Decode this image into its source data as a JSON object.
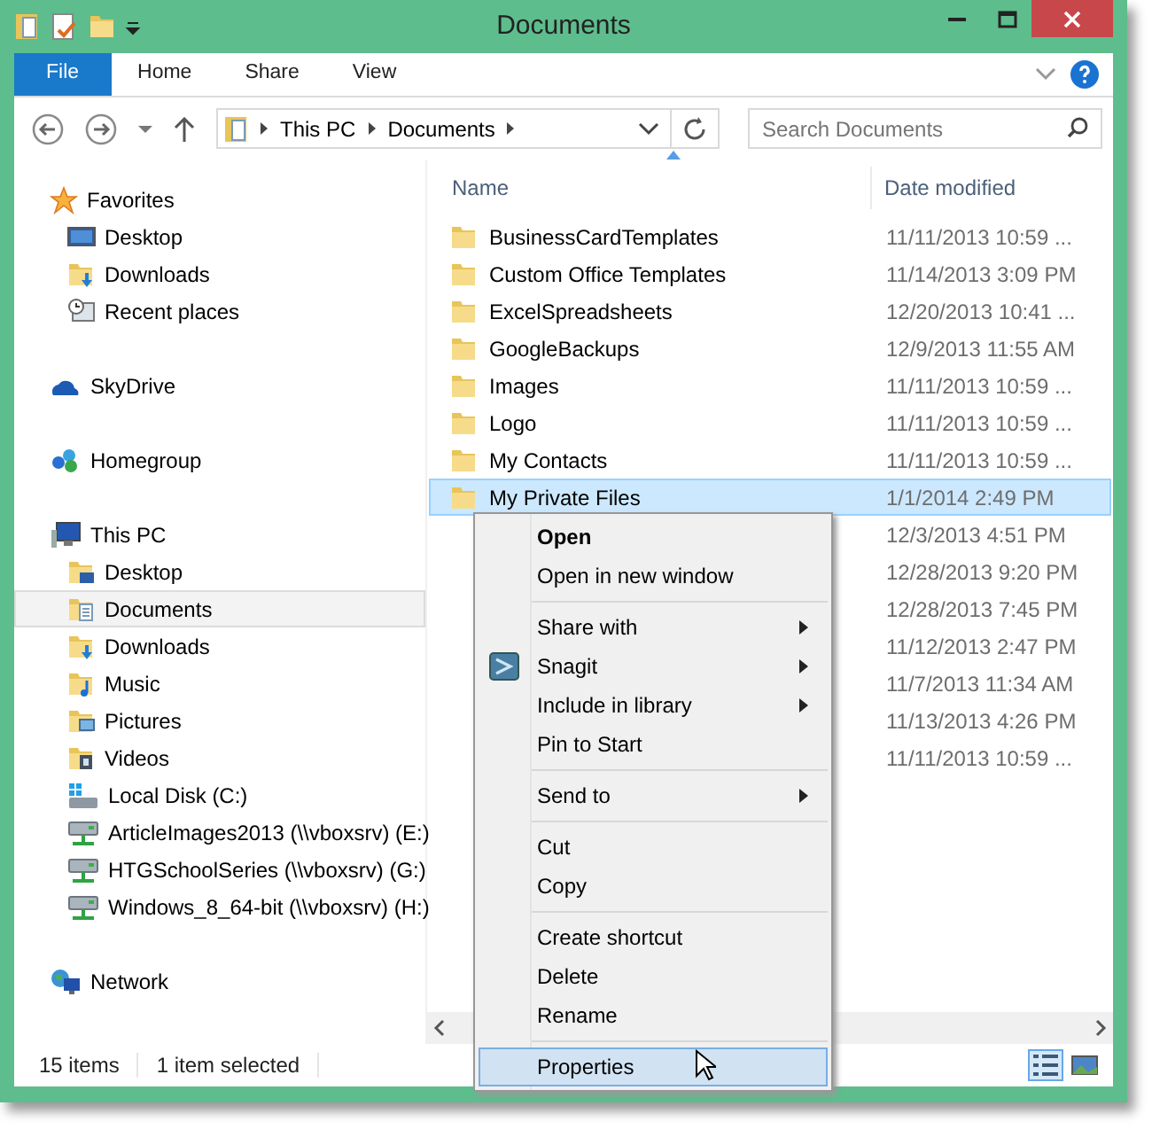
{
  "window": {
    "title": "Documents"
  },
  "ribbon_tabs": [
    {
      "label": "File",
      "kind": "file"
    },
    {
      "label": "Home",
      "kind": "tab"
    },
    {
      "label": "Share",
      "kind": "tab"
    },
    {
      "label": "View",
      "kind": "tab"
    }
  ],
  "address_bar": {
    "path": [
      "This PC",
      "Documents"
    ]
  },
  "search": {
    "placeholder": "Search Documents"
  },
  "navigation": [
    {
      "label": "Favorites",
      "kind": "star",
      "selected": false,
      "children": [
        {
          "label": "Desktop",
          "kind": "desktop",
          "selected": false
        },
        {
          "label": "Downloads",
          "kind": "download-folder",
          "selected": false
        },
        {
          "label": "Recent places",
          "kind": "recent",
          "selected": false
        }
      ]
    },
    {
      "label": "SkyDrive",
      "kind": "cloud",
      "selected": false
    },
    {
      "label": "Homegroup",
      "kind": "homegroup",
      "selected": false
    },
    {
      "label": "This PC",
      "kind": "computer",
      "selected": false,
      "children": [
        {
          "label": "Desktop",
          "kind": "desktop-folder",
          "selected": false
        },
        {
          "label": "Documents",
          "kind": "documents-folder",
          "selected": true
        },
        {
          "label": "Downloads",
          "kind": "download-folder",
          "selected": false
        },
        {
          "label": "Music",
          "kind": "music-folder",
          "selected": false
        },
        {
          "label": "Pictures",
          "kind": "pictures-folder",
          "selected": false
        },
        {
          "label": "Videos",
          "kind": "videos-folder",
          "selected": false
        },
        {
          "label": "Local Disk (C:)",
          "kind": "disk",
          "selected": false
        },
        {
          "label": "ArticleImages2013 (\\\\vboxsrv) (E:)",
          "kind": "network-drive",
          "selected": false
        },
        {
          "label": "HTGSchoolSeries (\\\\vboxsrv) (G:)",
          "kind": "network-drive",
          "selected": false
        },
        {
          "label": "Windows_8_64-bit (\\\\vboxsrv) (H:)",
          "kind": "network-drive",
          "selected": false
        }
      ]
    },
    {
      "label": "Network",
      "kind": "network",
      "selected": false
    }
  ],
  "file_list": {
    "columns": [
      "Name",
      "Date modified"
    ],
    "rows": [
      {
        "name": "BusinessCardTemplates",
        "date": "11/11/2013 10:59 ...",
        "selected": false
      },
      {
        "name": "Custom Office Templates",
        "date": "11/14/2013 3:09 PM",
        "selected": false
      },
      {
        "name": "ExcelSpreadsheets",
        "date": "12/20/2013 10:41 ...",
        "selected": false
      },
      {
        "name": "GoogleBackups",
        "date": "12/9/2013 11:55 AM",
        "selected": false
      },
      {
        "name": "Images",
        "date": "11/11/2013 10:59 ...",
        "selected": false
      },
      {
        "name": "Logo",
        "date": "11/11/2013 10:59 ...",
        "selected": false
      },
      {
        "name": "My Contacts",
        "date": "11/11/2013 10:59 ...",
        "selected": false
      },
      {
        "name": "My Private Files",
        "date": "1/1/2014 2:49 PM",
        "selected": true
      },
      {
        "date": "12/3/2013 4:51 PM",
        "selected": false
      },
      {
        "date": "12/28/2013 9:20 PM",
        "selected": false
      },
      {
        "date": "12/28/2013 7:45 PM",
        "selected": false
      },
      {
        "date": "11/12/2013 2:47 PM",
        "selected": false
      },
      {
        "date": "11/7/2013 11:34 AM",
        "selected": false
      },
      {
        "date": "11/13/2013 4:26 PM",
        "selected": false
      },
      {
        "date": "11/11/2013 10:59 ...",
        "selected": false
      }
    ]
  },
  "context_menu": [
    {
      "kind": "item",
      "label": "Open",
      "default": true,
      "submenu": false,
      "selected": false
    },
    {
      "kind": "item",
      "label": "Open in new window",
      "default": false,
      "submenu": false,
      "selected": false
    },
    {
      "kind": "separator"
    },
    {
      "kind": "item",
      "label": "Share with",
      "default": false,
      "submenu": true,
      "selected": false
    },
    {
      "kind": "item",
      "label": "Snagit",
      "default": false,
      "submenu": true,
      "selected": false,
      "icon": true
    },
    {
      "kind": "item",
      "label": "Include in library",
      "default": false,
      "submenu": true,
      "selected": false
    },
    {
      "kind": "item",
      "label": "Pin to Start",
      "default": false,
      "submenu": false,
      "selected": false
    },
    {
      "kind": "separator"
    },
    {
      "kind": "item",
      "label": "Send to",
      "default": false,
      "submenu": true,
      "selected": false
    },
    {
      "kind": "separator"
    },
    {
      "kind": "item",
      "label": "Cut",
      "default": false,
      "submenu": false,
      "selected": false
    },
    {
      "kind": "item",
      "label": "Copy",
      "default": false,
      "submenu": false,
      "selected": false
    },
    {
      "kind": "separator"
    },
    {
      "kind": "item",
      "label": "Create shortcut",
      "default": false,
      "submenu": false,
      "selected": false
    },
    {
      "kind": "item",
      "label": "Delete",
      "default": false,
      "submenu": false,
      "selected": false
    },
    {
      "kind": "item",
      "label": "Rename",
      "default": false,
      "submenu": false,
      "selected": false
    },
    {
      "kind": "separator"
    },
    {
      "kind": "item",
      "label": "Properties",
      "default": false,
      "submenu": false,
      "selected": true
    }
  ],
  "status_bar": {
    "items_count": "15 items",
    "selection": "1 item selected"
  },
  "view_buttons": [
    {
      "kind": "details",
      "selected": true
    },
    {
      "kind": "large-icons",
      "selected": false
    }
  ]
}
